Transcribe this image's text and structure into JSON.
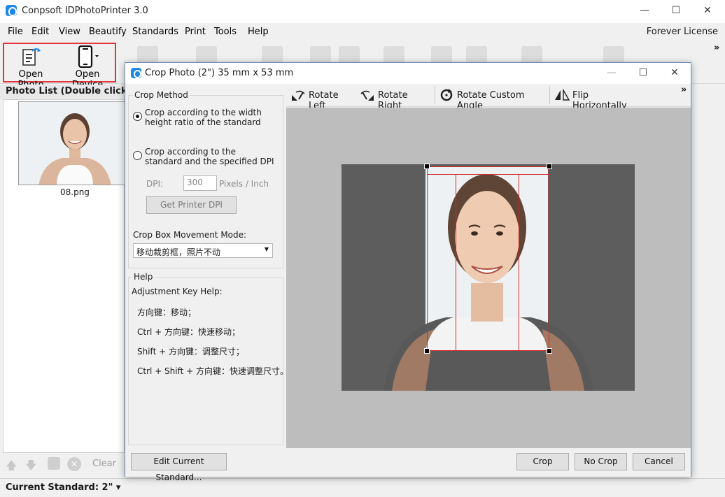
{
  "window": {
    "title": "Conpsoft IDPhotoPrinter 3.0",
    "minimize": "—",
    "maximize": "☐",
    "close": "✕"
  },
  "menu": [
    "File",
    "Edit",
    "View",
    "Beautify",
    "Standards",
    "Print",
    "Tools",
    "Help"
  ],
  "license": "Forever License",
  "toolbar": {
    "open_photo": "Open Photo",
    "open_device": "Open Device",
    "overflow": "»"
  },
  "photo_list": {
    "header": "Photo List (Double click to",
    "items": [
      {
        "name": "08.png"
      }
    ]
  },
  "bottom_tools": {
    "clear": "Clear"
  },
  "status": {
    "current_standard": "Current Standard: 2\" ▾"
  },
  "dialog": {
    "title": "Crop Photo (2\") 35 mm x 53 mm",
    "crop_method": {
      "legend": "Crop Method",
      "option1": "Crop according to the width height ratio of the standard",
      "option2": "Crop according to the standard and the specified DPI",
      "selected": 1,
      "dpi_label": "DPI:",
      "dpi_value": "300",
      "dpi_unit": "Pixels / Inch",
      "get_printer_dpi": "Get Printer DPI",
      "movement_label": "Crop Box Movement Mode:",
      "movement_value": "移动裁剪框，照片不动"
    },
    "help": {
      "legend": "Help",
      "title": "Adjustment Key Help:",
      "lines": [
        "方向键：移动；",
        "Ctrl + 方向键：快速移动；",
        "Shift + 方向键：调整尺寸；",
        "Ctrl + Shift + 方向键：快速调整尺寸。"
      ]
    },
    "rotate": {
      "left": "Rotate Left",
      "right": "Rotate Right",
      "custom": "Rotate Custom Angle",
      "flip": "Flip Horizontally",
      "overflow": "»"
    },
    "footer": {
      "edit_standard": "Edit Current Standard...",
      "crop": "Crop",
      "no_crop": "No Crop",
      "cancel": "Cancel"
    }
  },
  "colors": {
    "accent": "#1e88e5",
    "highlight_border": "#e0343a",
    "crop_line": "#d22a2a"
  }
}
